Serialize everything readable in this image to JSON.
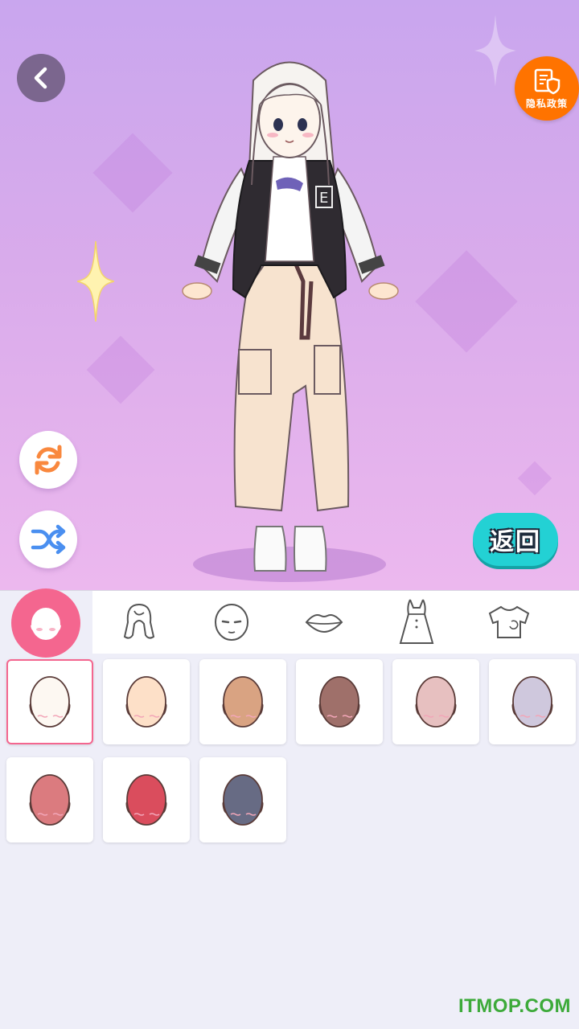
{
  "header": {
    "back_icon": "chevron-left-icon",
    "privacy": {
      "icon": "document-shield-icon",
      "label": "隐私政策"
    }
  },
  "tools": [
    {
      "name": "rotate",
      "icon": "refresh-icon"
    },
    {
      "name": "shuffle",
      "icon": "shuffle-icon"
    }
  ],
  "return_button": {
    "label": "返回"
  },
  "tabs": [
    {
      "id": "skin",
      "icon": "face-skin-icon",
      "active": true
    },
    {
      "id": "hair",
      "icon": "hair-icon",
      "active": false
    },
    {
      "id": "face",
      "icon": "face-features-icon",
      "active": false
    },
    {
      "id": "lips",
      "icon": "lips-icon",
      "active": false
    },
    {
      "id": "dress",
      "icon": "dress-icon",
      "active": false
    },
    {
      "id": "top",
      "icon": "shirt-icon",
      "active": false
    }
  ],
  "skin_colors": [
    {
      "color": "#fdf8f2",
      "selected": true
    },
    {
      "color": "#fde0c8",
      "selected": false
    },
    {
      "color": "#d9a382",
      "selected": false
    },
    {
      "color": "#9f706a",
      "selected": false
    },
    {
      "color": "#e7c0c0",
      "selected": false
    },
    {
      "color": "#cfc8dd",
      "selected": false
    },
    {
      "color": "#db7b7f",
      "selected": false
    },
    {
      "color": "#da4d5d",
      "selected": false
    },
    {
      "color": "#676b84",
      "selected": false
    }
  ],
  "colors": {
    "accent_pink": "#f4668f",
    "return_cyan": "#23d1d4",
    "privacy_orange": "#ff7300"
  },
  "watermark": "ITMOP.COM"
}
